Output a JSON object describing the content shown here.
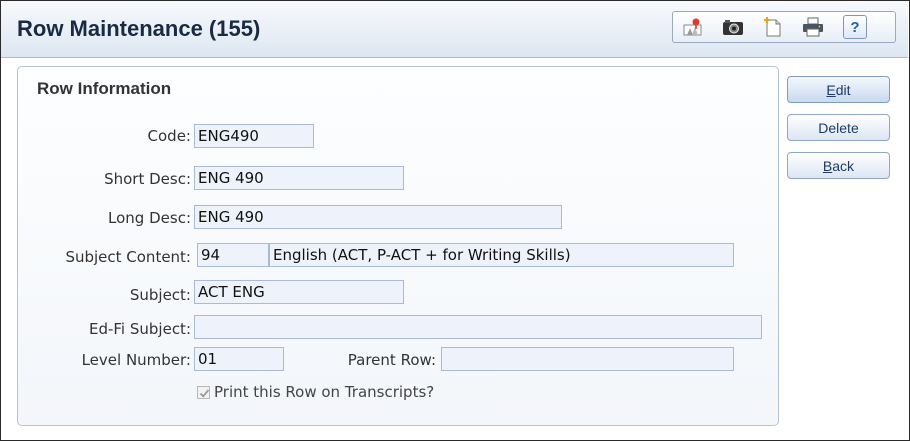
{
  "window": {
    "title": "Row Maintenance (155)",
    "help_label": "?"
  },
  "toolbar": {
    "icons": [
      "report-icon",
      "camera-icon",
      "new-record-icon",
      "print-icon",
      "help-icon"
    ]
  },
  "row_information": {
    "section_title": "Row Information",
    "code": {
      "label": "Code:",
      "value": "ENG490"
    },
    "short_desc": {
      "label": "Short Desc:",
      "value": "ENG 490"
    },
    "long_desc": {
      "label": "Long Desc:",
      "value": "ENG 490"
    },
    "subject_content": {
      "label": "Subject Content:",
      "code": "94",
      "description": "English (ACT, P-ACT + for Writing Skills)"
    },
    "subject": {
      "label": "Subject:",
      "value": "ACT ENG"
    },
    "ed_fi_subject": {
      "label": "Ed-Fi Subject:",
      "value": ""
    },
    "level_number": {
      "label": "Level Number:",
      "value": "01"
    },
    "parent_row": {
      "label": "Parent Row:",
      "value": ""
    },
    "print_on_transcripts": {
      "label": "Print this Row on Transcripts?",
      "checked": true
    }
  },
  "actions": {
    "edit": {
      "hotkey": "E",
      "rest": "dit"
    },
    "delete": {
      "label": "Delete"
    },
    "back": {
      "hotkey": "B",
      "rest": "ack"
    }
  },
  "colors": {
    "title_text": "#1b2a44",
    "field_bg": "#eef3fb",
    "field_border": "#a8bbd6",
    "button_text": "#1d3b66"
  }
}
